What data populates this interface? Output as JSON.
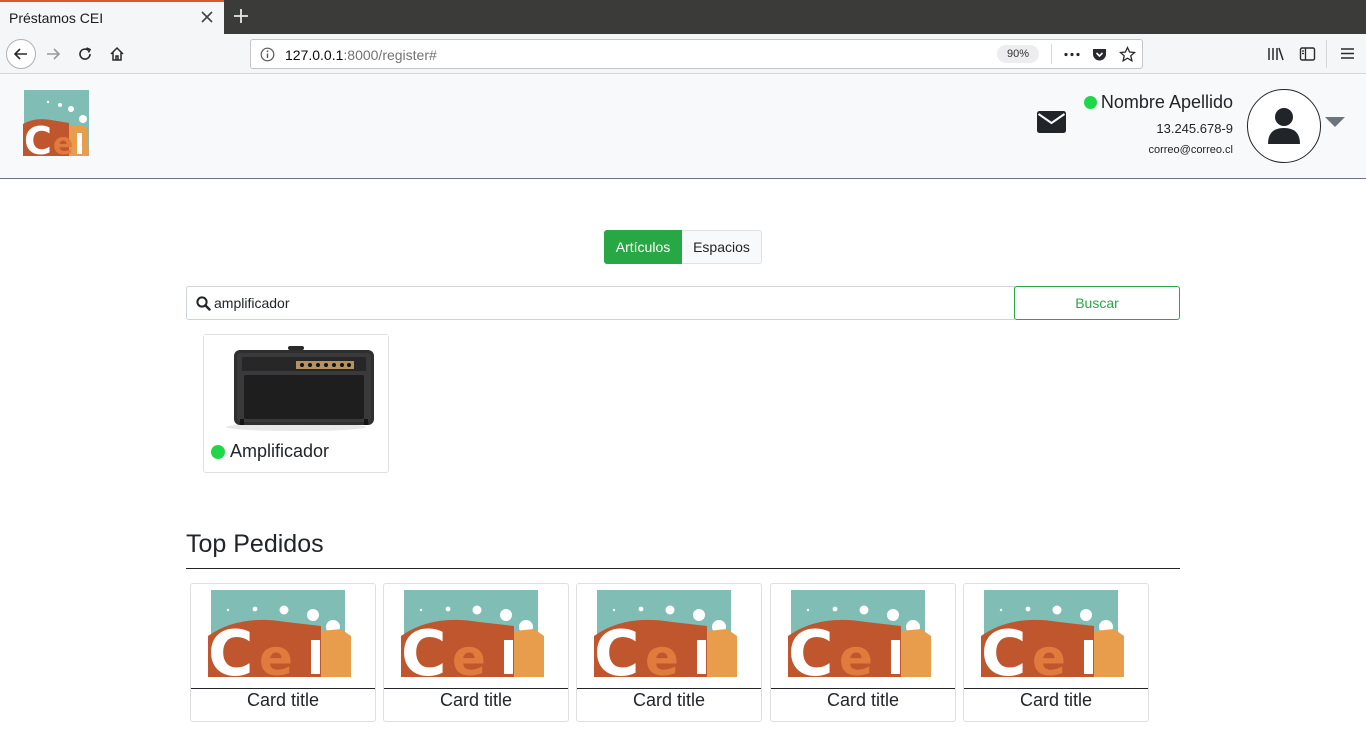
{
  "browser": {
    "tab_title": "Préstamos CEI",
    "url_host": "127.0.0.1",
    "url_rest": ":8000/register#",
    "zoom": "90%"
  },
  "header": {
    "logo_text": "Cei",
    "user_name": "Nombre Apellido",
    "user_rut": "13.245.678-9",
    "user_email": "correo@correo.cl",
    "status_color": "#1ed84a"
  },
  "toggle": {
    "active_label": "Artículos",
    "inactive_label": "Espacios"
  },
  "search": {
    "value": "amplificador",
    "button_label": "Buscar"
  },
  "results": [
    {
      "label": "Amplificador",
      "image": "amplifier"
    }
  ],
  "top_section": {
    "title": "Top Pedidos",
    "cards": [
      {
        "title": "Card title",
        "image": "cei-logo"
      },
      {
        "title": "Card title",
        "image": "cei-logo"
      },
      {
        "title": "Card title",
        "image": "cei-logo"
      },
      {
        "title": "Card title",
        "image": "cei-logo"
      },
      {
        "title": "Card title",
        "image": "cei-logo"
      }
    ]
  },
  "colors": {
    "accent_green": "#28a745",
    "logo_teal": "#7fbdb5",
    "logo_orange": "#c0562d"
  }
}
